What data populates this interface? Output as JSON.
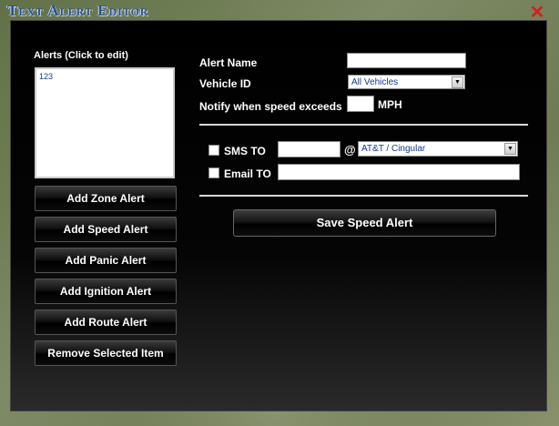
{
  "window": {
    "title": "Text Alert Editor"
  },
  "alerts_list": {
    "label": "Alerts  (Click to edit)",
    "items": [
      "123"
    ]
  },
  "side_buttons": {
    "add_zone": "Add Zone Alert",
    "add_speed": "Add Speed Alert",
    "add_panic": "Add Panic Alert",
    "add_ignition": "Add Ignition Alert",
    "add_route": "Add Route Alert",
    "remove_selected": "Remove Selected Item"
  },
  "form": {
    "alert_name_label": "Alert Name",
    "alert_name_value": "",
    "vehicle_id_label": "Vehicle ID",
    "vehicle_id_value": "All Vehicles",
    "speed_label": "Notify when speed exceeds",
    "speed_value": "",
    "speed_unit": "MPH",
    "sms_label": "SMS TO",
    "sms_value": "",
    "at_symbol": "@",
    "carrier_value": "AT&T / Cingular",
    "email_label": "Email TO",
    "email_value": ""
  },
  "actions": {
    "save_label": "Save Speed Alert"
  },
  "icons": {
    "close": "close-icon",
    "dropdown": "chevron-down-icon"
  },
  "colors": {
    "title": "#2a4f8a",
    "close": "#d81c1c",
    "panel": "#000000"
  }
}
